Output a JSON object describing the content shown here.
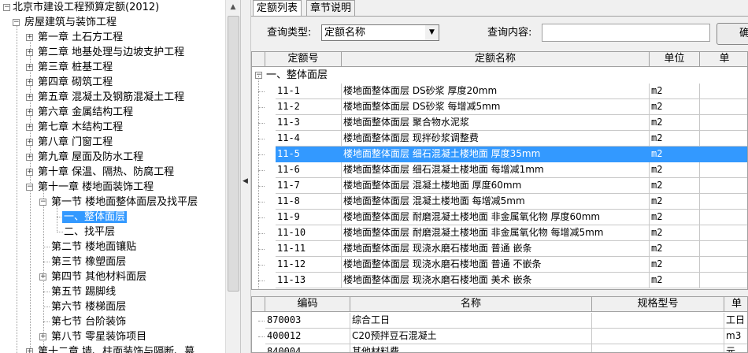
{
  "tree": {
    "root": "北京市建设工程预算定额(2012)",
    "group": "房屋建筑与装饰工程",
    "chapters": [
      "第一章 土石方工程",
      "第二章 地基处理与边坡支护工程",
      "第三章 桩基工程",
      "第四章 砌筑工程",
      "第五章 混凝土及钢筋混凝土工程",
      "第六章 金属结构工程",
      "第七章 木结构工程",
      "第八章 门窗工程",
      "第九章 屋面及防水工程",
      "第十章 保温、隔热、防腐工程"
    ],
    "ch11": "第十一章 楼地面装饰工程",
    "sec1": "第一节 楼地面整体面层及找平层",
    "sub1": "一、整体面层",
    "sub2": "二、找平层",
    "sections": [
      "第二节 楼地面镶贴",
      "第三节 橡塑面层",
      "第四节 其他材料面层",
      "第五节 踢脚线",
      "第六节 楼梯面层",
      "第七节 台阶装饰",
      "第八节 零星装饰项目"
    ],
    "ch12": "第十二章 墙、柱面装饰与隔断、幕"
  },
  "tabs": [
    "定额列表",
    "章节说明"
  ],
  "query": {
    "type_label": "查询类型:",
    "type_value": "定额名称",
    "content_label": "查询内容:",
    "content_value": "",
    "button_label": "确"
  },
  "grid": {
    "headers": [
      "定额号",
      "定额名称",
      "单位",
      "单"
    ],
    "group_label": "一、整体面层",
    "rows": [
      [
        "11-1",
        "楼地面整体面层 DS砂浆 厚度20mm",
        "m2"
      ],
      [
        "11-2",
        "楼地面整体面层 DS砂浆 每增减5mm",
        "m2"
      ],
      [
        "11-3",
        "楼地面整体面层 聚合物水泥浆",
        "m2"
      ],
      [
        "11-4",
        "楼地面整体面层 现拌砂浆调整费",
        "m2"
      ],
      [
        "11-5",
        "楼地面整体面层 细石混凝土楼地面 厚度35mm",
        "m2"
      ],
      [
        "11-6",
        "楼地面整体面层 细石混凝土楼地面 每增减1mm",
        "m2"
      ],
      [
        "11-7",
        "楼地面整体面层 混凝土楼地面 厚度60mm",
        "m2"
      ],
      [
        "11-8",
        "楼地面整体面层 混凝土楼地面 每增减5mm",
        "m2"
      ],
      [
        "11-9",
        "楼地面整体面层 耐磨混凝土楼地面 非金属氧化物 厚度60mm",
        "m2"
      ],
      [
        "11-10",
        "楼地面整体面层 耐磨混凝土楼地面 非金属氧化物 每增减5mm",
        "m2"
      ],
      [
        "11-11",
        "楼地面整体面层 现浇水磨石楼地面 普通 嵌条",
        "m2"
      ],
      [
        "11-12",
        "楼地面整体面层 现浇水磨石楼地面 普通 不嵌条",
        "m2"
      ],
      [
        "11-13",
        "楼地面整体面层 现浇水磨石楼地面 美术 嵌条",
        "m2"
      ]
    ]
  },
  "res": {
    "headers": [
      "编码",
      "名称",
      "规格型号",
      "单"
    ],
    "rows": [
      [
        "870003",
        "综合工日",
        "工日"
      ],
      [
        "400012",
        "C20预拌豆石混凝土",
        "m3"
      ],
      [
        "840004",
        "其他材料费",
        "元"
      ]
    ]
  }
}
